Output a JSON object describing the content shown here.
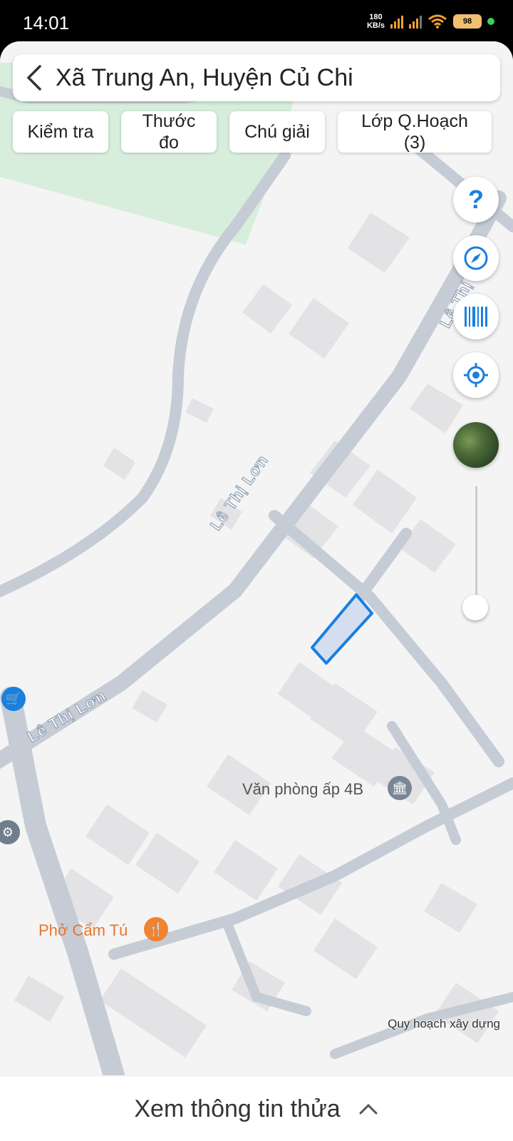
{
  "status_bar": {
    "time": "14:01",
    "network_speed_value": "180",
    "network_speed_unit": "KB/s",
    "battery": "98"
  },
  "search": {
    "title": "Xã Trung An, Huyện Củ Chi",
    "back_icon": "chevron-left-icon"
  },
  "toolbar": {
    "check_label": "Kiểm tra",
    "measure_label_line1": "Thước",
    "measure_label_line2": "đo",
    "legend_label": "Chú giải",
    "layers_label_line1": "Lớp Q.Hoạch",
    "layers_label_line2": "(3)"
  },
  "map_controls": {
    "help_icon": "question-icon",
    "compass_icon": "compass-icon",
    "barcode_icon": "barcode-icon",
    "locate_icon": "crosshair-icon",
    "satellite_icon": "satellite-thumbnail",
    "accent_color": "#1a7fe0"
  },
  "map": {
    "road_labels": [
      "Lê Thị Lơn",
      "Lê Thị Lơn",
      "Lê Thị Lơn"
    ],
    "poi_office": "Văn phòng ấp 4B",
    "poi_restaurant": "Phở Cẩm Tú",
    "attribution": "Quy hoạch xây dựng",
    "parcel_color": "#1a7fe0"
  },
  "bottom_sheet": {
    "title": "Xem thông tin thửa",
    "expand_icon": "chevron-up-icon"
  }
}
